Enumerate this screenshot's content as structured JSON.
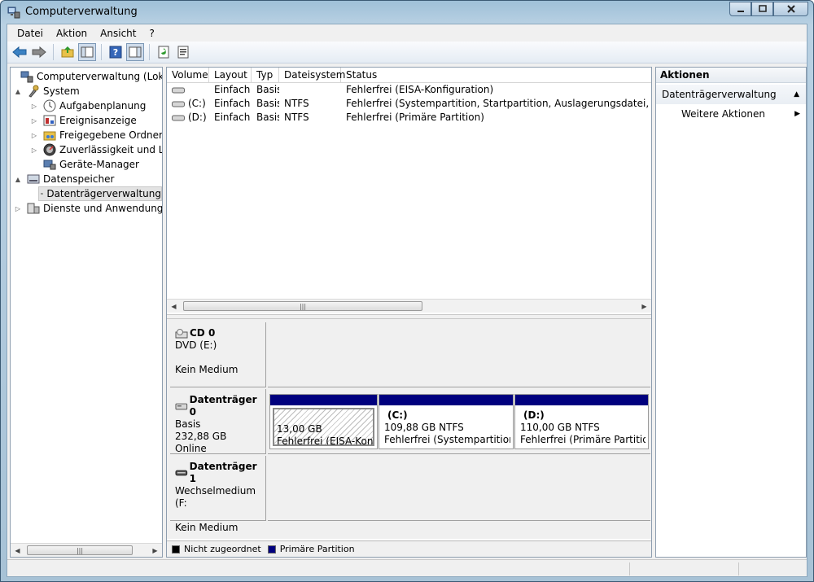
{
  "window": {
    "title": "Computerverwaltung"
  },
  "menu": [
    "Datei",
    "Aktion",
    "Ansicht",
    "?"
  ],
  "tree": [
    {
      "label": "Computerverwaltung (Lokal)",
      "level": 0,
      "expander": "",
      "icon": "computer-management-icon"
    },
    {
      "label": "System",
      "level": 1,
      "expander": "▲",
      "icon": "system-tools-icon"
    },
    {
      "label": "Aufgabenplanung",
      "level": 2,
      "expander": "▷",
      "icon": "task-scheduler-icon"
    },
    {
      "label": "Ereignisanzeige",
      "level": 2,
      "expander": "▷",
      "icon": "event-viewer-icon"
    },
    {
      "label": "Freigegebene Ordner",
      "level": 2,
      "expander": "▷",
      "icon": "shared-folders-icon"
    },
    {
      "label": "Zuverlässigkeit und Leis",
      "level": 2,
      "expander": "▷",
      "icon": "reliability-icon"
    },
    {
      "label": "Geräte-Manager",
      "level": 2,
      "expander": "",
      "icon": "device-manager-icon"
    },
    {
      "label": "Datenspeicher",
      "level": 1,
      "expander": "▲",
      "icon": "storage-icon"
    },
    {
      "label": "Datenträgerverwaltung",
      "level": 2,
      "expander": "",
      "icon": "disk-management-icon",
      "selected": true
    },
    {
      "label": "Dienste und Anwendungen",
      "level": 1,
      "expander": "▷",
      "icon": "services-icon"
    }
  ],
  "volume_list": {
    "columns": [
      "Volume",
      "Layout",
      "Typ",
      "Dateisystem",
      "Status"
    ],
    "rows": [
      {
        "volume": "",
        "layout": "Einfach",
        "typ": "Basis",
        "fs": "",
        "status": "Fehlerfrei (EISA-Konfiguration)"
      },
      {
        "volume": "(C:)",
        "layout": "Einfach",
        "typ": "Basis",
        "fs": "NTFS",
        "status": "Fehlerfrei (Systempartition, Startpartition, Auslagerungsdatei, Aktiv, Ab"
      },
      {
        "volume": "(D:)",
        "layout": "Einfach",
        "typ": "Basis",
        "fs": "NTFS",
        "status": "Fehlerfrei (Primäre Partition)"
      }
    ]
  },
  "disks": [
    {
      "title": "CD 0",
      "line1": "DVD (E:)",
      "line2": "",
      "line3": "Kein Medium",
      "icon": "cd-drive-icon"
    },
    {
      "title": "Datenträger 0",
      "line1": "Basis",
      "line2": "232,88 GB",
      "line3": "Online",
      "icon": "hard-disk-icon",
      "partitions": [
        {
          "name": "",
          "size": "13,00 GB",
          "status": "Fehlerfrei (EISA-Konfig"
        },
        {
          "name": "(C:)",
          "size": "109,88 GB NTFS",
          "status": "Fehlerfrei (Systempartition, S"
        },
        {
          "name": "(D:)",
          "size": "110,00 GB NTFS",
          "status": "Fehlerfrei (Primäre Partition)"
        }
      ]
    },
    {
      "title": "Datenträger 1",
      "line1": "Wechselmedium (F:",
      "line2": "",
      "line3": "Kein Medium",
      "icon": "removable-disk-icon"
    }
  ],
  "legend": [
    {
      "label": "Nicht zugeordnet",
      "color": "#000000"
    },
    {
      "label": "Primäre Partition",
      "color": "#00007e"
    }
  ],
  "actions": {
    "header": "Aktionen",
    "section": "Datenträgerverwaltung",
    "item": "Weitere Aktionen"
  }
}
